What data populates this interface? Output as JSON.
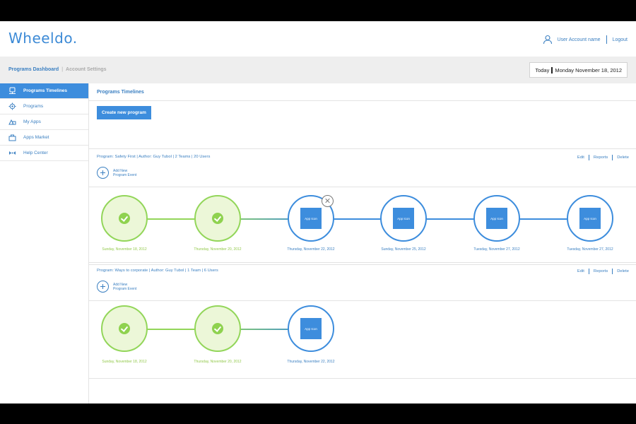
{
  "header": {
    "logo": "Wheeldo.",
    "user_account": "User Account name",
    "logout": "Logout"
  },
  "breadcrumb": {
    "active": "Programs Dashboard",
    "separator": "|",
    "inactive": "Account Settings"
  },
  "date": {
    "prefix": "Today",
    "value": "Monday November 18, 2012"
  },
  "sidebar": {
    "items": [
      {
        "label": "Programs Timelines",
        "icon": "timeline-icon",
        "active": true
      },
      {
        "label": "Programs",
        "icon": "gear-icon",
        "active": false
      },
      {
        "label": "My Apps",
        "icon": "apps-icon",
        "active": false
      },
      {
        "label": "Apps Market",
        "icon": "market-icon",
        "active": false
      },
      {
        "label": "Help Center",
        "icon": "help-icon",
        "active": false
      }
    ]
  },
  "main": {
    "title": "Programs Timelines",
    "create_button": "Create new program",
    "add_event_line1": "Add  New",
    "add_event_line2": "Program Event",
    "actions": {
      "edit": "Edit",
      "reports": "Reports",
      "delete": "Delete"
    }
  },
  "programs": [
    {
      "info": "Program: Safety First  |  Author: Guy Tubol  |  2 Teams  |  20 Users",
      "nodes": [
        {
          "status": "done",
          "date": "Sunday, November 18, 2012"
        },
        {
          "status": "done",
          "date": "Thursday, November 20, 2012"
        },
        {
          "status": "app",
          "label": "App Icon",
          "date": "Thursday, November 22, 2012",
          "removable": true
        },
        {
          "status": "app",
          "label": "App Icon",
          "date": "Sunday, November 25, 2012"
        },
        {
          "status": "app",
          "label": "App Icon",
          "date": "Tuesday, November 27, 2012"
        },
        {
          "status": "app",
          "label": "App Icon",
          "date": "Tuesday, November 27, 2012"
        }
      ]
    },
    {
      "info": "Program: Ways to corporate  |  Author: Guy Tubol  |  1 Team  |  6 Users",
      "nodes": [
        {
          "status": "done",
          "date": "Sunday, November 18, 2012"
        },
        {
          "status": "done",
          "date": "Thursday, November 20, 2012"
        },
        {
          "status": "app",
          "label": "App Icon",
          "date": "Thursday, November 22, 2012"
        }
      ]
    }
  ],
  "colors": {
    "brand_blue": "#3d8ddd",
    "done_green": "#93d65a",
    "done_fill": "#ecf7d8"
  }
}
